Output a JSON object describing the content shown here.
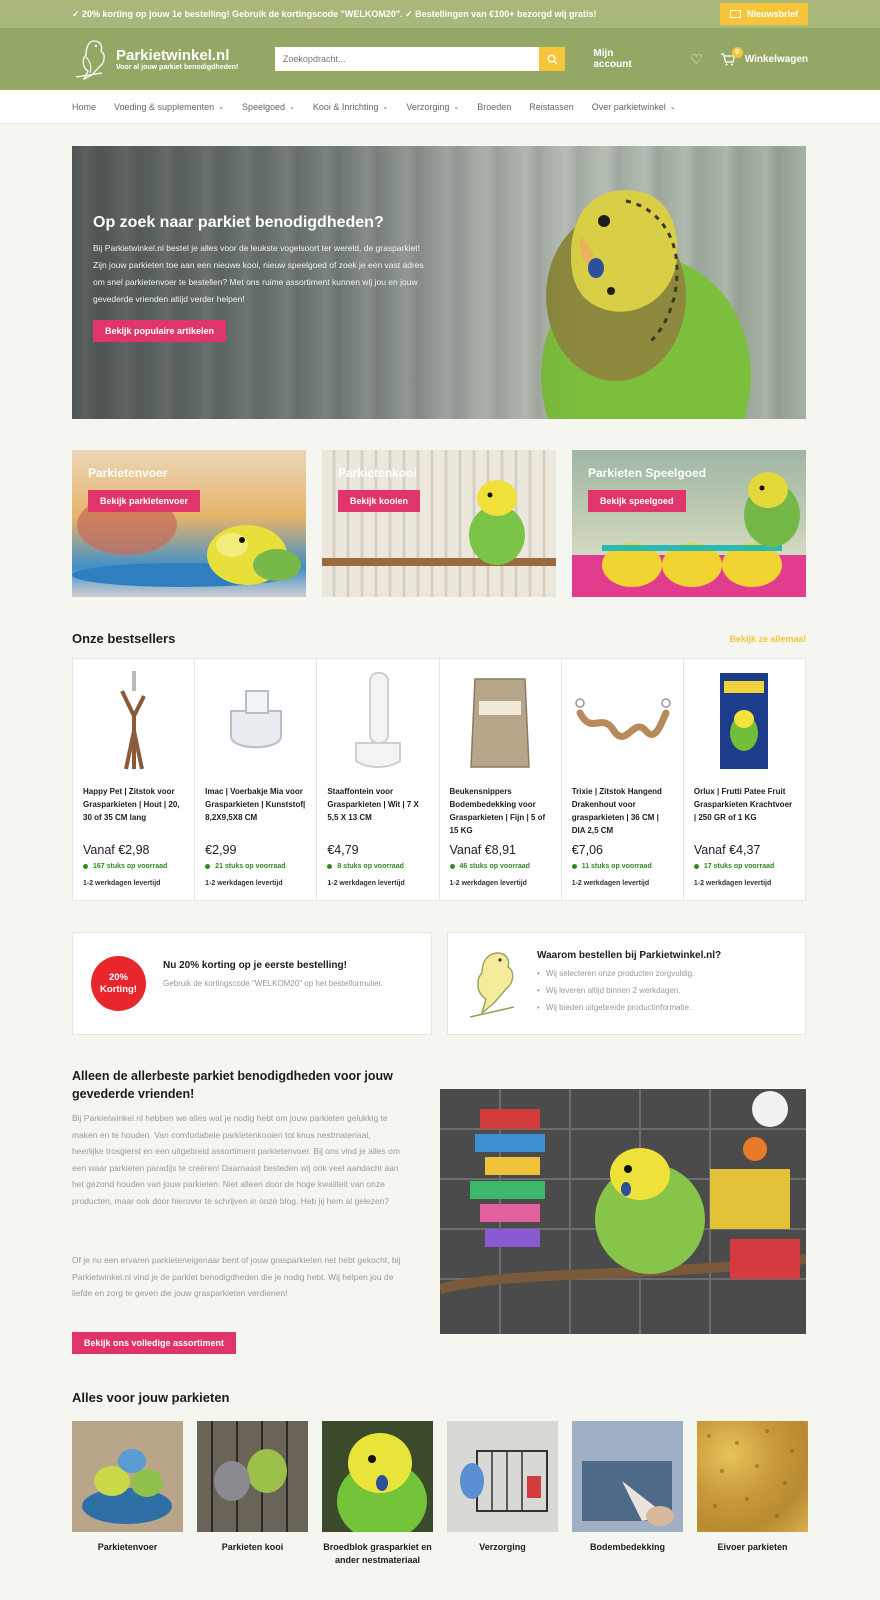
{
  "announcement": {
    "text": "✓ 20% korting op jouw 1e bestelling! Gebruik de kortingscode \"WELKOM20\". ✓ Bestellingen van €100+ bezorgd wij gratis!",
    "newsletter_label": "Nieuwsbrief"
  },
  "header": {
    "logo_title": "Parkietwinkel.nl",
    "logo_tagline": "Voor al jouw parkiet benodigdheden!",
    "search_placeholder": "Zoekopdracht...",
    "account_label": "Mijn account",
    "cart_count": "0",
    "cart_label": "Winkelwagen"
  },
  "nav": {
    "items": [
      {
        "label": "Home",
        "dropdown": false
      },
      {
        "label": "Voeding & supplementen",
        "dropdown": true
      },
      {
        "label": "Speelgoed",
        "dropdown": true
      },
      {
        "label": "Kooi & Inrichting",
        "dropdown": true
      },
      {
        "label": "Verzorging",
        "dropdown": true
      },
      {
        "label": "Broeden",
        "dropdown": false
      },
      {
        "label": "Reistassen",
        "dropdown": false
      },
      {
        "label": "Over parkietwinkel",
        "dropdown": true
      }
    ]
  },
  "hero": {
    "title": "Op zoek naar parkiet benodigdheden?",
    "text": "Bij Parkietwinkel.nl bestel je alles voor de leukste vogelsoort ter wereld, de grasparkiet! Zijn jouw parkieten toe aan een nieuwe kooi, nieuw speelgoed of zoek je een vast adres om snel parkietenvoer te bestellen? Met ons ruime assortiment kunnen wij jou en jouw gevederde vrienden altijd verder helpen!",
    "button": "Bekijk populaire artikelen"
  },
  "tiles": [
    {
      "title": "Parkietenvoer",
      "button": "Bekijk parkietenvoer"
    },
    {
      "title": "Parkietenkooi",
      "button": "Bekijk kooien"
    },
    {
      "title": "Parkieten Speelgoed",
      "button": "Bekijk speelgoed"
    }
  ],
  "bestsellers": {
    "title": "Onze bestsellers",
    "see_all": "Bekijk ze allemaal",
    "products": [
      {
        "name": "Happy Pet | Zitstok voor Grasparkieten | Hout | 20, 30 of 35 CM lang",
        "price": "Vanaf €2,98",
        "stock": "167 stuks op voorraad",
        "delivery": "1-2 werkdagen levertijd"
      },
      {
        "name": "Imac | Voerbakje Mia voor Grasparkieten | Kunststof| 8,2X9,5X8 CM",
        "price": "€2,99",
        "stock": "21 stuks op voorraad",
        "delivery": "1-2 werkdagen levertijd"
      },
      {
        "name": "Staaffontein voor Grasparkieten | Wit | 7 X 5,5 X 13 CM",
        "price": "€4,79",
        "stock": "8 stuks op voorraad",
        "delivery": "1-2 werkdagen levertijd"
      },
      {
        "name": "Beukensnippers Bodembedekking voor Grasparkieten | Fijn | 5 of 15 KG",
        "price": "Vanaf €8,91",
        "stock": "46 stuks op voorraad",
        "delivery": "1-2 werkdagen levertijd"
      },
      {
        "name": "Trixie | Zitstok Hangend Drakenhout voor grasparkieten | 36 CM | DIA 2,5 CM",
        "price": "€7,06",
        "stock": "11 stuks op voorraad",
        "delivery": "1-2 werkdagen levertijd"
      },
      {
        "name": "Orlux | Frutti Patee Fruit Grasparkieten Krachtvoer | 250 GR of 1 KG",
        "price": "Vanaf €4,37",
        "stock": "17 stuks op voorraad",
        "delivery": "1-2 werkdagen levertijd"
      }
    ]
  },
  "promo": {
    "badge_line1": "20%",
    "badge_line2": "Korting!",
    "title": "Nu 20% korting op je eerste bestelling!",
    "text": "Gebruik de kortingscode \"WELKOM20\" op het bestelformulier."
  },
  "why": {
    "title": "Waarom bestellen bij Parkietwinkel.nl?",
    "items": [
      "Wij selecteren onze producten zorgvuldig.",
      "Wij leveren altijd binnen 2 werkdagen.",
      "Wij bieden uitgebreide productinformatie."
    ]
  },
  "about": {
    "title": "Alleen de allerbeste parkiet benodigdheden voor jouw gevederde vrienden!",
    "p1": "Bij Parkietwinkel.nl hebben we alles wat je nodig hebt om jouw parkieten gelukkig te maken en te houden. Van comfortabele parkietenkooien tot knus nestmateriaal, heerlijke trosgierst en een uitgebreid assortiment parkietenvoer. Bij ons vind je alles om een waar parkieten paradijs te creëren! Daarnaast besteden wij ook veel aandacht aan het gezond houden van jouw parkieten. Niet alleen door de hoge kwaliteit van onze producten, maar ook door hierover te schrijven in onze blog. Heb jij hem al gelezen?",
    "p2": "Of je nu een ervaren parkieteneigenaar bent of jouw grasparkieten net hebt gekocht, bij Parkietwinkel.nl vind je de parkiet benodigdheden die je nodig hebt. Wij helpen jou de liefde en zorg te geven die jouw grasparkieten verdienen!",
    "button": "Bekijk ons volledige assortiment"
  },
  "all_for": {
    "title": "Alles voor jouw parkieten",
    "items": [
      "Parkietenvoer",
      "Parkieten kooi",
      "Broedblok grasparkiet en ander nestmateriaal",
      "Verzorging",
      "Bodembedekking",
      "Eivoer parkieten"
    ]
  },
  "colors": {
    "header_green": "#94a866",
    "announce_green": "#a7b87a",
    "accent_yellow": "#f6c53a",
    "button_pink": "#e0356a",
    "stock_green": "#2f8a1f",
    "badge_red": "#e8262b"
  }
}
